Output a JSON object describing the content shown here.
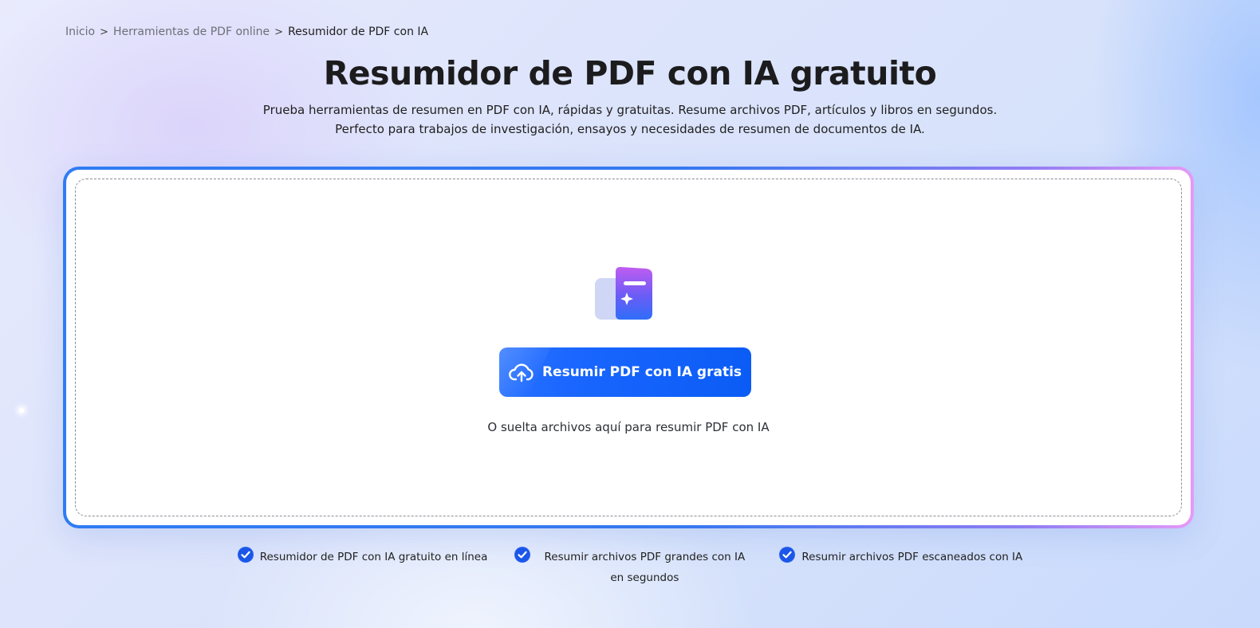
{
  "breadcrumb": {
    "items": [
      "Inicio",
      "Herramientas de PDF online"
    ],
    "current": "Resumidor de PDF con IA",
    "separator": ">"
  },
  "hero": {
    "title": "Resumidor de PDF con IA gratuito",
    "subtitle_line1": "Prueba herramientas de resumen en PDF con IA, rápidas y gratuitas. Resume archivos PDF, artículos y libros en segundos.",
    "subtitle_line2": "Perfecto para trabajos de investigación, ensayos y necesidades de resumen de documentos de IA."
  },
  "upload": {
    "icon": "ai-folder-icon",
    "button_icon": "cloud-upload-icon",
    "button_label": "Resumir PDF con IA gratis",
    "drop_hint": "O suelta archivos aquí para resumir PDF con IA"
  },
  "features": [
    {
      "icon": "check-badge-icon",
      "label": "Resumidor de PDF con IA gratuito en línea"
    },
    {
      "icon": "check-badge-icon",
      "label": "Resumir archivos PDF grandes con IA en segundos"
    },
    {
      "icon": "check-badge-icon",
      "label": "Resumir archivos PDF escaneados con IA"
    }
  ],
  "colors": {
    "accent": "#0a5cf5",
    "border_gradient_start": "#2f7cf3",
    "border_gradient_end": "#e59af6",
    "title": "#1c1c1e"
  }
}
